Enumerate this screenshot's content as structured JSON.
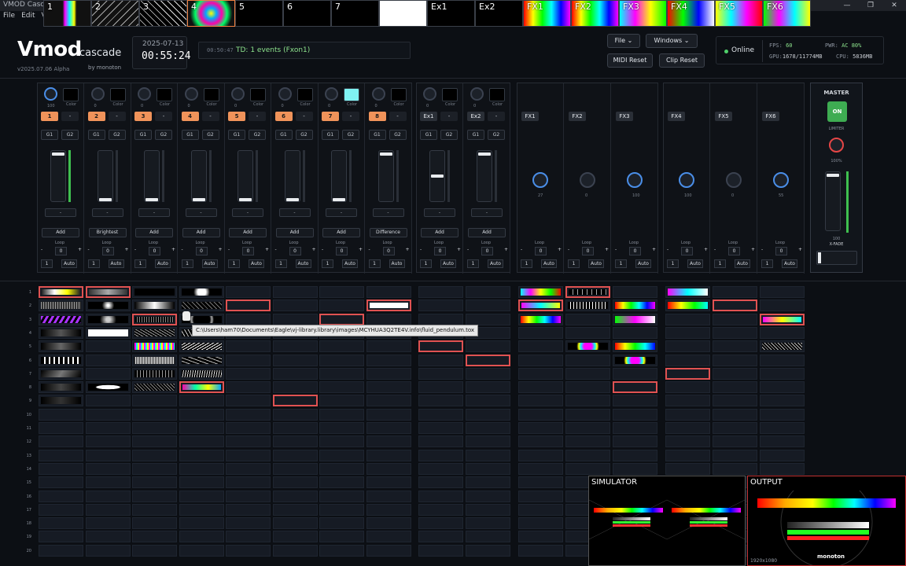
{
  "window": {
    "title": "VMOD Casc",
    "controls": [
      "—",
      "❐",
      "✕"
    ]
  },
  "menu": [
    "File",
    "Edit",
    "Vi"
  ],
  "thumbs": [
    "1",
    "2",
    "3",
    "4",
    "5",
    "6",
    "7",
    "",
    "Ex1",
    "Ex2",
    "FX1",
    "FX2",
    "FX3",
    "FX4",
    "FX5",
    "FX6"
  ],
  "logo": {
    "main": "Vmod",
    "sub": "cascade",
    "version": "v2025.07.06 Alpha",
    "by": "by monoton"
  },
  "clock": {
    "date": "2025-07-13",
    "time": "00:55:24"
  },
  "log": {
    "timestamp": "00:50:47",
    "message": "TD: 1 events (Fxon1)"
  },
  "header_buttons": {
    "file": "File ⌄",
    "windows": "Windows ⌄",
    "midi_reset": "MIDI Reset",
    "clip_reset": "Clip Reset"
  },
  "status": {
    "online": "Online",
    "fps_label": "FPS:",
    "fps": "60",
    "pwr_label": "PWR:",
    "pwr": "AC 80%",
    "gpu_label": "GPU:",
    "gpu": "1678/11774MB",
    "cpu_label": "CPU:",
    "cpu": "5836MB"
  },
  "channels": [
    {
      "knob": "100",
      "num": "1",
      "mode": "Add",
      "loop": "0",
      "step": "1"
    },
    {
      "knob": "0",
      "num": "2",
      "mode": "Brightest",
      "loop": "0",
      "step": "1"
    },
    {
      "knob": "0",
      "num": "3",
      "mode": "Add",
      "loop": "0",
      "step": "1"
    },
    {
      "knob": "0",
      "num": "4",
      "mode": "Add",
      "loop": "0",
      "step": "1"
    },
    {
      "knob": "0",
      "num": "5",
      "mode": "Add",
      "loop": "0",
      "step": "1"
    },
    {
      "knob": "0",
      "num": "6",
      "mode": "Add",
      "loop": "0",
      "step": "1"
    },
    {
      "knob": "0",
      "num": "7",
      "mode": "Add",
      "loop": "0",
      "step": "1"
    },
    {
      "knob": "0",
      "num": "8",
      "mode": "Difference",
      "loop": "0",
      "step": "1"
    }
  ],
  "ext_channels": [
    {
      "knob": "0",
      "num": "Ex1",
      "mode": "Add",
      "loop": "0",
      "step": "1"
    },
    {
      "knob": "0",
      "num": "Ex2",
      "mode": "Add",
      "loop": "0",
      "step": "1"
    }
  ],
  "fx_channels": [
    {
      "name": "FX1",
      "knob": "27",
      "loop": "0",
      "step": "1"
    },
    {
      "name": "FX2",
      "knob": "0",
      "loop": "0",
      "step": "1"
    },
    {
      "name": "FX3",
      "knob": "100",
      "loop": "0",
      "step": "1"
    },
    {
      "name": "FX4",
      "knob": "100",
      "loop": "0",
      "step": "1"
    },
    {
      "name": "FX5",
      "knob": "0",
      "loop": "0",
      "step": "1"
    },
    {
      "name": "FX6",
      "knob": "55",
      "loop": "0",
      "step": "1"
    }
  ],
  "labels": {
    "color": "Color",
    "g1": "G1",
    "g2": "G2",
    "dash": "-",
    "loop": "Loop",
    "minus": "-",
    "plus": "+",
    "auto": "Auto"
  },
  "master": {
    "title": "MASTER",
    "on": "ON",
    "limiter": "LIMITER",
    "limiter_val": "100%",
    "fader_val": "100",
    "xfade": "X-FADE"
  },
  "rows": [
    "1",
    "2",
    "3",
    "4",
    "5",
    "6",
    "7",
    "8",
    "9",
    "10",
    "11",
    "12",
    "13",
    "14",
    "15",
    "16",
    "17",
    "18",
    "19",
    "20"
  ],
  "tooltip": "C:\\Users\\ham70\\Documents\\Eagle\\vj-library.library\\images\\MCYHUA3Q2TE4V.info\\fluid_pendulum.tox",
  "panels": {
    "simulator": "SIMULATOR",
    "output": "OUTPUT",
    "resolution": "1920x1080",
    "brand": "monoton"
  },
  "colors": {
    "accent_orange": "#f0935a",
    "active_green": "#3eac52",
    "highlight_red": "#e05252",
    "log_green": "#8de38d"
  }
}
